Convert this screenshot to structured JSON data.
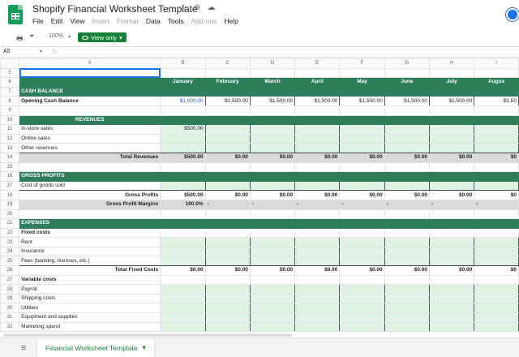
{
  "doc": {
    "title": "Shopify Financial Worksheet Template"
  },
  "title_icons": [
    "☆",
    "⊛",
    "☁"
  ],
  "menu": [
    "File",
    "Edit",
    "View",
    "Insert",
    "Format",
    "Data",
    "Tools",
    "Add-ons",
    "Help"
  ],
  "menu_dim": [
    false,
    false,
    false,
    true,
    true,
    false,
    false,
    true,
    false
  ],
  "toolbar": {
    "print_icon": "🖶",
    "filter_icon": "⏷",
    "zoom": "100%",
    "zoom_caret": "▾",
    "view_only": "View only",
    "view_caret": "▾"
  },
  "formula_bar": {
    "cell_ref": "A5",
    "caret": "▾",
    "fx": "fx"
  },
  "columns": [
    "",
    "A",
    "B",
    "C",
    "D",
    "E",
    "F",
    "G",
    "H",
    "I"
  ],
  "months": [
    "January",
    "February",
    "March",
    "April",
    "May",
    "June",
    "July",
    "Augus"
  ],
  "rows": [
    {
      "n": "5",
      "type": "blank",
      "a": "",
      "vals": []
    },
    {
      "n": "6",
      "type": "months",
      "a": "",
      "vals": []
    },
    {
      "n": "7",
      "type": "section",
      "a": "CASH BALANCE",
      "vals": []
    },
    {
      "n": "8",
      "type": "opening",
      "a": "Opening Cash Balance",
      "vals": [
        "$1,000.00",
        "$1,500.00",
        "$1,500.00",
        "$1,500.00",
        "$1,500.00",
        "$1,500.00",
        "$1,500.00",
        "$1,50"
      ]
    },
    {
      "n": "9",
      "type": "blank",
      "a": "",
      "vals": []
    },
    {
      "n": "10",
      "type": "section-center",
      "a": "REVENUES",
      "vals": []
    },
    {
      "n": "11",
      "type": "input",
      "a": "In-store sales",
      "vals": [
        "$500.00",
        "",
        "",
        "",
        "",
        "",
        "",
        ""
      ]
    },
    {
      "n": "12",
      "type": "input",
      "a": "Online sales",
      "vals": []
    },
    {
      "n": "13",
      "type": "input-last",
      "a": "Other revenues",
      "vals": []
    },
    {
      "n": "14",
      "type": "total",
      "a": "Total Revenues",
      "vals": [
        "$500.00",
        "$0.00",
        "$0.00",
        "$0.00",
        "$0.00",
        "$0.00",
        "$0.00",
        "$0"
      ]
    },
    {
      "n": "15",
      "type": "blank",
      "a": "",
      "vals": []
    },
    {
      "n": "16",
      "type": "section",
      "a": "GROSS PROFITS",
      "vals": []
    },
    {
      "n": "17",
      "type": "input-last",
      "a": "Cost of goods sold",
      "vals": []
    },
    {
      "n": "18",
      "type": "subtotal",
      "a": "Gross Profits",
      "vals": [
        "$500.00",
        "$0.00",
        "$0.00",
        "$0.00",
        "$0.00",
        "$0.00",
        "$0.00",
        "$0"
      ]
    },
    {
      "n": "19",
      "type": "margins",
      "a": "Gross Profit Margins",
      "vals": [
        "100.0%",
        "-",
        "-",
        "-",
        "-",
        "-",
        "-",
        "-"
      ]
    },
    {
      "n": "20",
      "type": "blank",
      "a": "",
      "vals": []
    },
    {
      "n": "21",
      "type": "section",
      "a": "EXPENSES",
      "vals": []
    },
    {
      "n": "22",
      "type": "label-bold",
      "a": "Fixed costs",
      "vals": []
    },
    {
      "n": "23",
      "type": "input",
      "a": "Rent",
      "vals": []
    },
    {
      "n": "24",
      "type": "input",
      "a": "Insurance",
      "vals": []
    },
    {
      "n": "25",
      "type": "input-last",
      "a": "Fees (banking, licenses, etc.)",
      "vals": []
    },
    {
      "n": "26",
      "type": "subtotal",
      "a": "Total Fixed Costs",
      "vals": [
        "$0.00",
        "$0.00",
        "$0.00",
        "$0.00",
        "$0.00",
        "$0.00",
        "$0.00",
        "$0"
      ]
    },
    {
      "n": "27",
      "type": "label-bold",
      "a": "Variable costs",
      "vals": []
    },
    {
      "n": "28",
      "type": "input",
      "a": "Payroll",
      "vals": []
    },
    {
      "n": "29",
      "type": "input",
      "a": "Shipping costs",
      "vals": []
    },
    {
      "n": "30",
      "type": "input",
      "a": "Utilities",
      "vals": []
    },
    {
      "n": "31",
      "type": "input",
      "a": "Equipment and supplies",
      "vals": []
    },
    {
      "n": "32",
      "type": "input",
      "a": "Marketing spend",
      "vals": []
    }
  ],
  "bottom": {
    "sheets_icon": "≡",
    "tab_label": "Financial Worksheet Template",
    "tab_caret": "▾"
  },
  "colors": {
    "green_header": "#2e7d5b",
    "input_fill": "#dff3e4",
    "total_fill": "#d9d9d9",
    "view_only": "#188038",
    "link_blue": "#1a56db"
  }
}
